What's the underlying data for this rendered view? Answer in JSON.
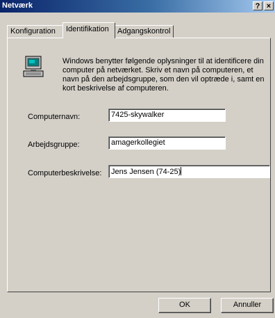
{
  "window": {
    "title": "Netværk",
    "help_glyph": "?",
    "close_glyph": "×",
    "title_gradient": [
      "#0a246a",
      "#a6caf0"
    ]
  },
  "tabs": [
    {
      "label": "Konfiguration",
      "active": false
    },
    {
      "label": "Identifikation",
      "active": true
    },
    {
      "label": "Adgangskontrol",
      "active": false
    }
  ],
  "identification": {
    "icon": "computer-icon",
    "description": "Windows benytter følgende oplysninger til at identificere din computer på netværket. Skriv et navn på computeren, et navn på den arbejdsgruppe, som den vil optræde i, samt en kort beskrivelse af computeren.",
    "fields": {
      "computer_name": {
        "label": "Computernavn:",
        "value": "7425-skywalker"
      },
      "workgroup": {
        "label": "Arbejdsgruppe:",
        "value": "amagerkollegiet"
      },
      "description": {
        "label": "Computerbeskrivelse:",
        "value": "Jens Jensen (74-25)"
      }
    }
  },
  "buttons": {
    "ok": "OK",
    "cancel": "Annuller"
  }
}
